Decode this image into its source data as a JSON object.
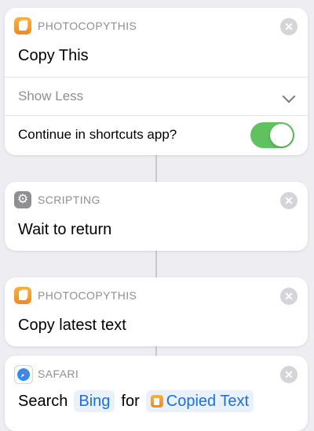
{
  "cards": [
    {
      "app": "PHOTOCOPYTHIS",
      "title": "Copy This",
      "show_less": "Show Less",
      "continue_label": "Continue in shortcuts app?",
      "continue_toggle_on": true
    },
    {
      "app": "SCRIPTING",
      "title": "Wait to return"
    },
    {
      "app": "PHOTOCOPYTHIS",
      "title": "Copy latest text"
    },
    {
      "app": "SAFARI",
      "search_word": "Search",
      "engine": "Bing",
      "for_word": "for",
      "variable": "Copied Text"
    }
  ],
  "icons": {
    "photocopy": "photocopy-app-icon",
    "scripting": "gear-icon",
    "safari": "compass-icon",
    "close": "close-icon",
    "chevron": "chevron-down-icon"
  },
  "colors": {
    "toggle_on": "#5fc25e",
    "token_text": "#1f6fd6",
    "token_bg": "#e9f1fc",
    "background": "#eeeef2"
  }
}
